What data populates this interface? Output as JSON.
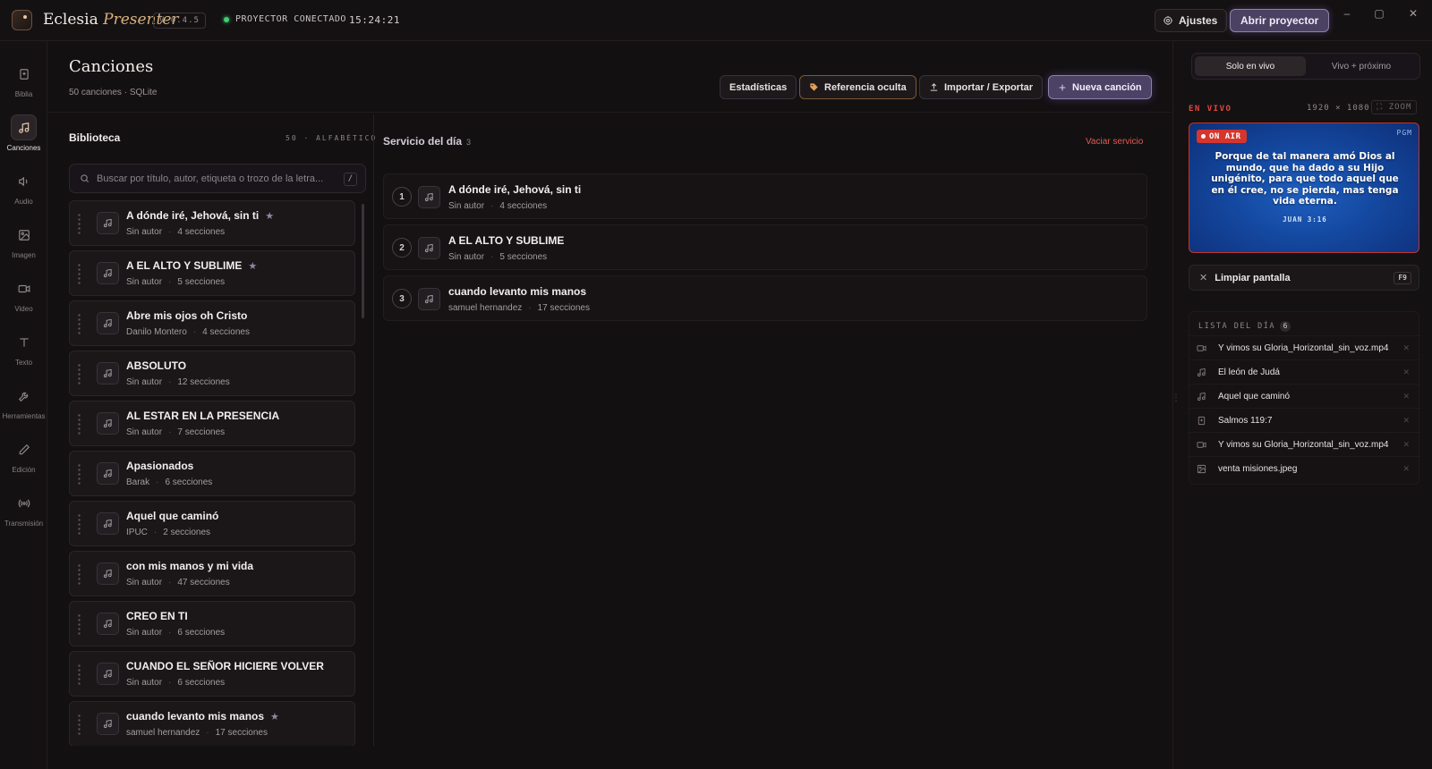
{
  "app": {
    "brand_main": "Eclesia",
    "brand_script": "Presenter",
    "version": "V 0.4.5",
    "connection_status": "PROYECTOR CONECTADO",
    "clock": "15:24:21",
    "settings_label": "Ajustes",
    "open_projector_label": "Abrir proyector",
    "accent_color": "#4b4265",
    "live_color": "#d4362d"
  },
  "rail": {
    "items": [
      {
        "label": "Biblia",
        "icon": "book-icon"
      },
      {
        "label": "Canciones",
        "icon": "music-note-icon"
      },
      {
        "label": "Audio",
        "icon": "speaker-icon"
      },
      {
        "label": "Imagen",
        "icon": "image-icon"
      },
      {
        "label": "Video",
        "icon": "video-icon"
      },
      {
        "label": "Texto",
        "icon": "text-icon"
      },
      {
        "label": "Herramientas",
        "icon": "wrench-icon"
      },
      {
        "label": "Edición",
        "icon": "pencil-icon"
      },
      {
        "label": "Transmisión",
        "icon": "broadcast-icon"
      }
    ]
  },
  "header": {
    "title": "Canciones",
    "subtitle": "50 canciones · SQLite",
    "btn_stats": "Estadísticas",
    "btn_hidden_ref": "Referencia oculta",
    "btn_import_export": "Importar / Exportar",
    "btn_new_song": "Nueva canción"
  },
  "library": {
    "title": "Biblioteca",
    "meta": "50 · ALFABÉTICO",
    "search_placeholder": "Buscar por título, autor, etiqueta o trozo de la letra...",
    "search_shortcut": "/",
    "songs": [
      {
        "title": "A dónde iré, Jehová, sin ti",
        "author": "Sin autor",
        "sections": "4 secciones",
        "star": "★"
      },
      {
        "title": "A EL ALTO Y SUBLIME",
        "author": "Sin autor",
        "sections": "5 secciones",
        "star": "★"
      },
      {
        "title": "Abre mis ojos oh Cristo",
        "author": "Danilo Montero",
        "sections": "4 secciones",
        "star": ""
      },
      {
        "title": "ABSOLUTO",
        "author": "Sin autor",
        "sections": "12 secciones",
        "star": ""
      },
      {
        "title": "AL ESTAR EN LA PRESENCIA",
        "author": "Sin autor",
        "sections": "7 secciones",
        "star": ""
      },
      {
        "title": "Apasionados",
        "author": "Barak",
        "sections": "6 secciones",
        "star": ""
      },
      {
        "title": "Aquel que caminó",
        "author": "IPUC",
        "sections": "2 secciones",
        "star": ""
      },
      {
        "title": "con mis manos y mi vida",
        "author": "Sin autor",
        "sections": "47 secciones",
        "star": ""
      },
      {
        "title": "CREO EN TI",
        "author": "Sin autor",
        "sections": "6 secciones",
        "star": ""
      },
      {
        "title": "CUANDO EL SEÑOR HICIERE VOLVER",
        "author": "Sin autor",
        "sections": "6 secciones",
        "star": ""
      },
      {
        "title": "cuando levanto mis manos",
        "author": "samuel hernandez",
        "sections": "17 secciones",
        "star": "★"
      }
    ]
  },
  "service": {
    "title": "Servicio del día",
    "count": "3",
    "clear_label": "Vaciar servicio",
    "items": [
      {
        "num": "1",
        "title": "A dónde iré, Jehová, sin ti",
        "author": "Sin autor",
        "sections": "4 secciones"
      },
      {
        "num": "2",
        "title": "A EL ALTO Y SUBLIME",
        "author": "Sin autor",
        "sections": "5 secciones"
      },
      {
        "num": "3",
        "title": "cuando levanto mis manos",
        "author": "samuel hernandez",
        "sections": "17 secciones"
      }
    ]
  },
  "live": {
    "mode_options": [
      "Solo en vivo",
      "Vivo + próximo"
    ],
    "mode_selected": "Solo en vivo",
    "label": "EN VIVO",
    "resolution": "1920 × 1080",
    "zoom_label": "ZOOM",
    "on_air": "ON AIR",
    "pgm": "PGM",
    "verse_text": "Porque de tal manera amó Dios al mundo, que ha dado a su Hijo unigénito, para que todo aquel que en él cree, no se pierda, mas tenga vida eterna.",
    "verse_ref": "JUAN 3:16",
    "clear_screen_label": "Limpiar pantalla",
    "clear_screen_key": "F9"
  },
  "day_list": {
    "title": "LISTA DEL DÍA",
    "count": "6",
    "items": [
      {
        "label": "Y vimos su Gloria_Horizontal_sin_voz.mp4",
        "icon": "video-icon"
      },
      {
        "label": "El león de Judá",
        "icon": "music-note-icon"
      },
      {
        "label": "Aquel que caminó",
        "icon": "music-note-icon"
      },
      {
        "label": "Salmos 119:7",
        "icon": "book-icon"
      },
      {
        "label": "Y vimos su Gloria_Horizontal_sin_voz.mp4",
        "icon": "video-icon"
      },
      {
        "label": "venta misiones.jpeg",
        "icon": "image-icon"
      }
    ]
  }
}
